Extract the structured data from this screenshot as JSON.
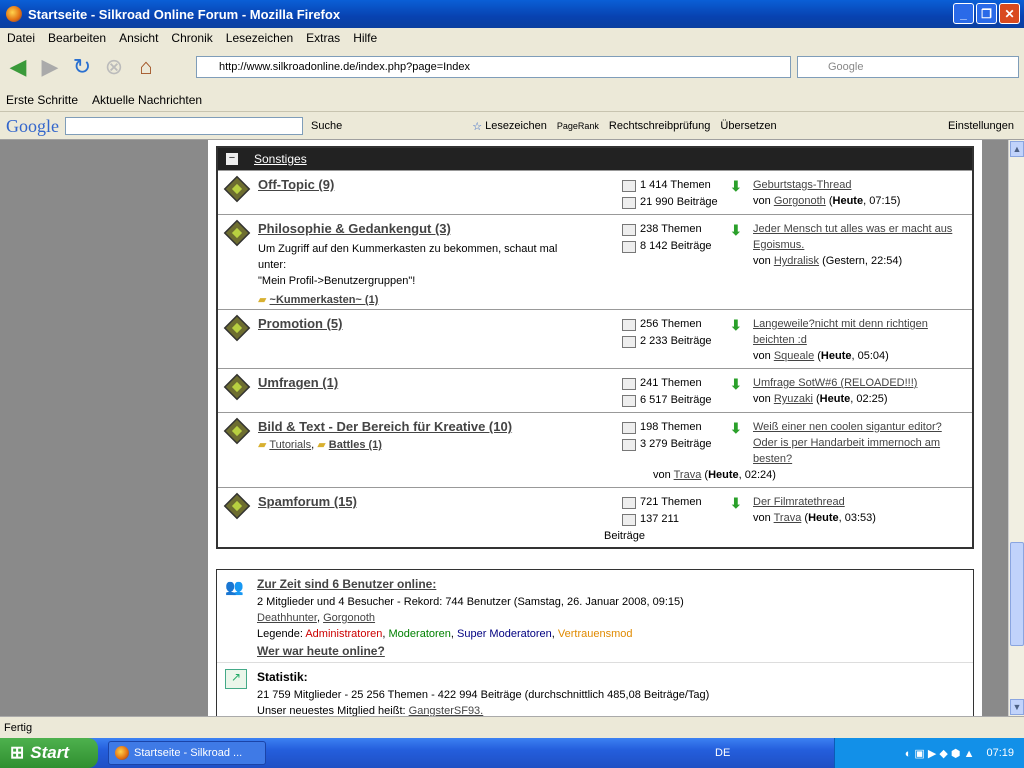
{
  "window": {
    "title": "Startseite - Silkroad Online Forum - Mozilla Firefox"
  },
  "menu": [
    "Datei",
    "Bearbeiten",
    "Ansicht",
    "Chronik",
    "Lesezeichen",
    "Extras",
    "Hilfe"
  ],
  "nav": {
    "url": "http://www.silkroadonline.de/index.php?page=Index",
    "search_placeholder": "Google"
  },
  "bookmarks": [
    "Erste Schritte",
    "Aktuelle Nachrichten"
  ],
  "google_toolbar": {
    "logo": "Google",
    "suche": "Suche",
    "lesezeichen": "Lesezeichen",
    "pagerank": "PageRank",
    "spell": "Rechtschreibprüfung",
    "translate": "Übersetzen",
    "settings": "Einstellungen"
  },
  "category": "Sonstiges",
  "forums": [
    {
      "name": "Off-Topic (9)",
      "desc": [],
      "themen": "1 414 Themen",
      "beitraege": "21 990 Beiträge",
      "last_title": "Geburtstags-Thread",
      "last_by": "von",
      "last_user": "Gorgonoth",
      "last_when": "Heute",
      "last_time": ", 07:15)"
    },
    {
      "name": "Philosophie & Gedankengut (3)",
      "desc": [
        "Um Zugriff auf den Kummerkasten zu bekommen, schaut mal unter:",
        "\"Mein Profil->Benutzergruppen\"!"
      ],
      "sub": "~Kummerkasten~ (1)",
      "themen": "238 Themen",
      "beitraege": "8 142 Beiträge",
      "last_title": "Jeder Mensch tut alles was er macht aus Egoismus.",
      "last_by": "von",
      "last_user": "Hydralisk",
      "last_when": "(Gestern, 22:54)"
    },
    {
      "name": "Promotion (5)",
      "themen": "256 Themen",
      "beitraege": "2 233 Beiträge",
      "last_title": "Langeweile?nicht mit denn richtigen beichten :d",
      "last_by": "von",
      "last_user": "Squeale",
      "last_when": "Heute",
      "last_time": ", 05:04)"
    },
    {
      "name": "Umfragen (1)",
      "themen": "241 Themen",
      "beitraege": "6 517 Beiträge",
      "last_title": "Umfrage SotW#6 (RELOADED!!!)",
      "last_by": "von",
      "last_user": "Ryuzaki",
      "last_when": "Heute",
      "last_time": ", 02:25)"
    },
    {
      "name": "Bild & Text - Der Bereich für Kreative (10)",
      "subs": [
        "Tutorials",
        "Battles (1)"
      ],
      "themen": "198 Themen",
      "beitraege": "3 279 Beiträge",
      "last_title": "Weiß einer nen coolen sigantur editor? Oder is per Handarbeit immernoch am besten?",
      "last_by": "von",
      "last_user": "Trava",
      "last_when": "Heute",
      "last_time": ", 02:24)"
    },
    {
      "name": "Spamforum (15)",
      "themen": "721 Themen",
      "beitraege": "137 211",
      "beitraege2": "Beiträge",
      "last_title": "Der Filmratethread",
      "last_by": "von",
      "last_user": "Trava",
      "last_when": "Heute",
      "last_time": ", 03:53)"
    }
  ],
  "online": {
    "title": "Zur Zeit sind 6 Benutzer online:",
    "line1": "2 Mitglieder und 4 Besucher - Rekord: 744 Benutzer (Samstag, 26. Januar 2008, 09:15)",
    "users": [
      "Deathhunter",
      "Gorgonoth"
    ],
    "legend_label": "Legende:",
    "legend": [
      {
        "t": "Administratoren",
        "c": "#cc0000"
      },
      {
        "t": "Moderatoren",
        "c": "#008000"
      },
      {
        "t": "Super Moderatoren",
        "c": "#000080"
      },
      {
        "t": "Vertrauensmod",
        "c": "#e08a00"
      }
    ],
    "today": "Wer war heute online?",
    "stat_title": "Statistik:",
    "stat_line": "21 759 Mitglieder - 25 256 Themen - 422 994 Beiträge (durchschnittlich 485,08 Beiträge/Tag)",
    "newest": "Unser neuestes Mitglied heißt:",
    "newest_user": "GangsterSF93."
  },
  "status": "Fertig",
  "taskbar": {
    "start": "Start",
    "task": "Startseite - Silkroad ...",
    "lang": "DE",
    "time": "07:19"
  }
}
